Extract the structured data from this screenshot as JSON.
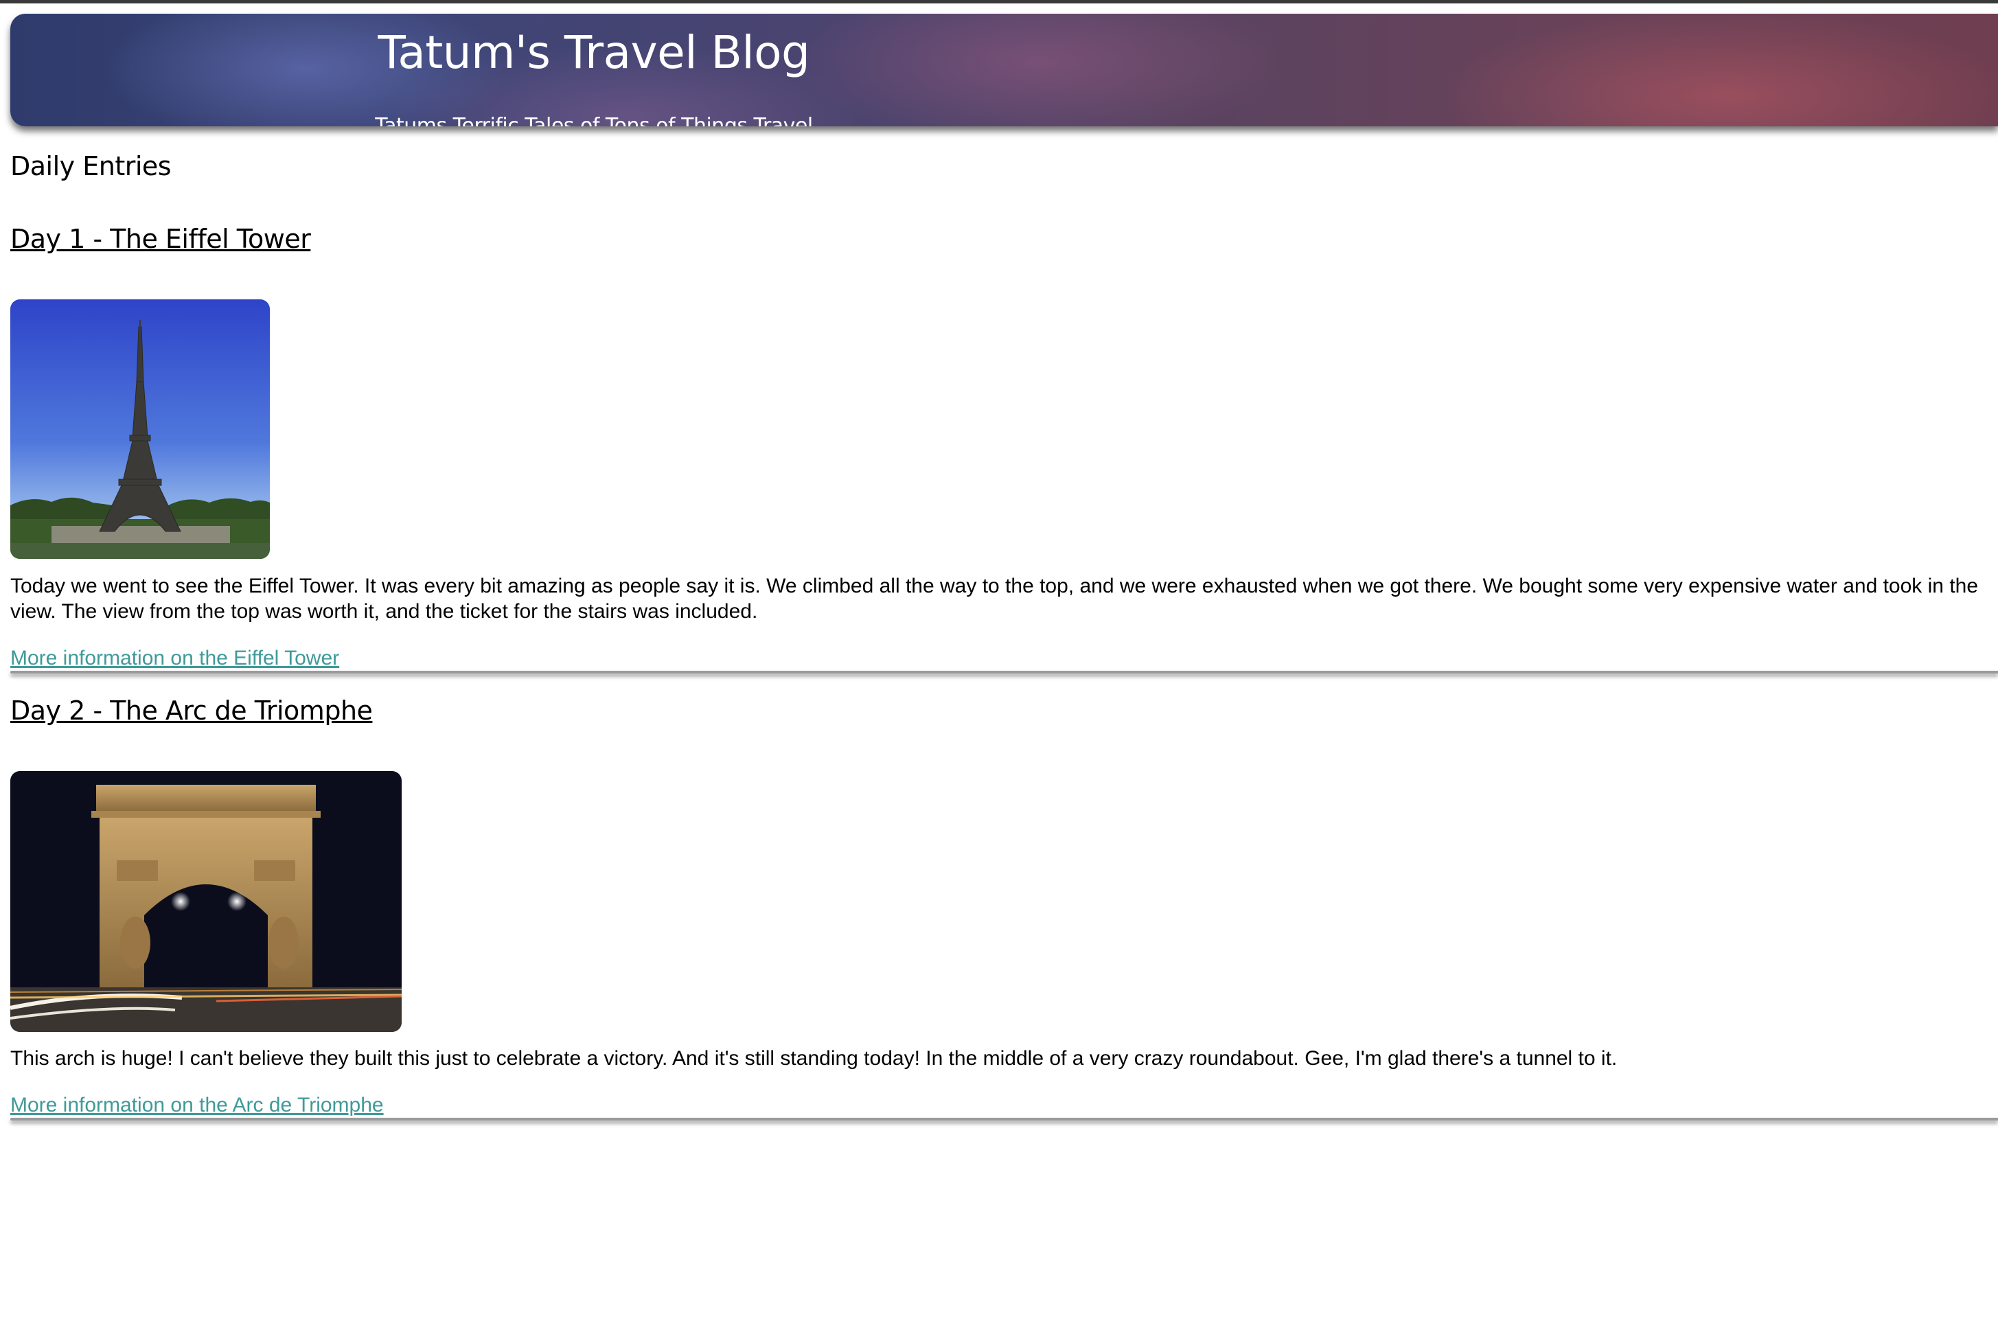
{
  "header": {
    "title": "Tatum's Travel Blog",
    "subtitle": "Tatums Terrific Tales of Tons of Things Travel"
  },
  "section_heading": "Daily Entries",
  "entries": [
    {
      "title": "Day 1 - The Eiffel Tower",
      "image": "eiffel-tower-photo",
      "text": "Today we went to see the Eiffel Tower. It was every bit amazing as people say it is. We climbed all the way to the top, and we were exhausted when we got there. We bought some very expensive water and took in the view. The view from the top was worth it, and the ticket for the stairs was included.",
      "link": "More information on the Eiffel Tower"
    },
    {
      "title": "Day 2 - The Arc de Triomphe",
      "image": "arc-de-triomphe-photo",
      "text": "This arch is huge! I can't believe they built this just to celebrate a victory. And it's still standing today! In the middle of a very crazy roundabout. Gee, I'm glad there's a tunnel to it.",
      "link": "More information on the Arc de Triomphe"
    }
  ],
  "colors": {
    "link": "#3f9a98",
    "header_gradient_start": "#2f3b6c",
    "header_gradient_end": "#6f3e50"
  }
}
